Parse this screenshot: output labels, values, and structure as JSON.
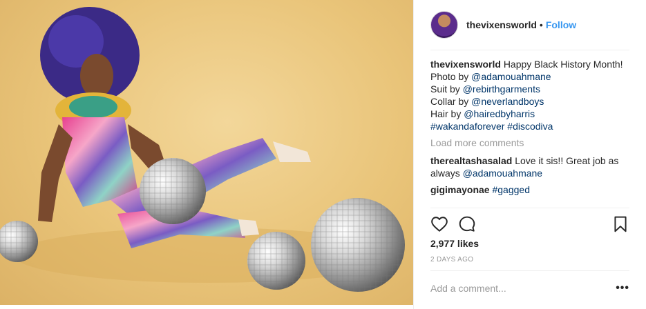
{
  "post": {
    "author": "thevixensworld",
    "follow_label": "Follow",
    "separator": "•"
  },
  "caption": {
    "username": "thevixensworld",
    "line1": "Happy Black History Month!",
    "photo_prefix": "Photo by ",
    "photo_handle": "@adamouahmane",
    "suit_prefix": "Suit by ",
    "suit_handle": "@rebirthgarments",
    "collar_prefix": "Collar by ",
    "collar_handle": "@neverlandboys",
    "hair_prefix": "Hair by ",
    "hair_handle": "@hairedbyharris",
    "tag1": "#wakandaforever",
    "tag2": "#discodiva"
  },
  "load_more": "Load more comments",
  "comments": [
    {
      "username": "therealtashasalad",
      "text": "Love it sis!! Great job as always ",
      "mention": "@adamouahmane"
    },
    {
      "username": "gigimayonae",
      "text": "",
      "mention": "#gagged"
    }
  ],
  "likes": "2,977 likes",
  "time_ago": "2 DAYS AGO",
  "add_comment_placeholder": "Add a comment...",
  "more_options": "•••",
  "icons": {
    "like": "heart-icon",
    "comment": "comment-icon",
    "save": "bookmark-icon"
  }
}
